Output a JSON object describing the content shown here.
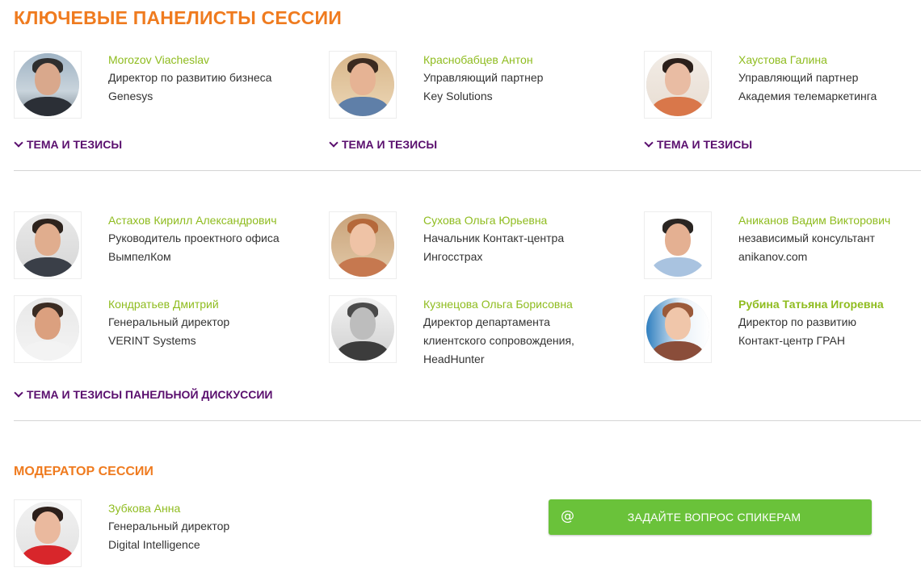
{
  "page": {
    "title": "КЛЮЧЕВЫЕ ПАНЕЛИСТЫ СЕССИИ",
    "moderator_title": "МОДЕРАТОР СЕССИИ",
    "ask_button": {
      "icon": "at-icon",
      "icon_glyph": "@",
      "label": "ЗАДАЙТЕ ВОПРОС СПИКЕРАМ"
    }
  },
  "colors": {
    "accent_orange": "#ef7b1f",
    "name_green": "#8fbc1f",
    "link_purple": "#5a0f6e",
    "button_green": "#6ac23a"
  },
  "panel1": {
    "speakers": [
      {
        "name": "Morozov Viacheslav",
        "lines": [
          "Директор по развитию бизнеса",
          "Genesys"
        ]
      },
      {
        "name": "Краснобабцев Антон",
        "lines": [
          "Управляющий партнер",
          "Key Solutions"
        ]
      },
      {
        "name": "Хаустова Галина",
        "lines": [
          "Управляющий партнер",
          "Академия телемаркетинга"
        ]
      }
    ],
    "theses_label": "ТЕМА И ТЕЗИСЫ"
  },
  "panel2": {
    "speakers": [
      {
        "name": "Астахов Кирилл Александрович",
        "lines": [
          "Руководитель проектного офиса",
          "ВымпелКом"
        ]
      },
      {
        "name": "Сухова Ольга Юрьевна",
        "lines": [
          "Начальник Контакт-центра",
          "Ингосстрах"
        ]
      },
      {
        "name": "Аниканов Вадим Викторович",
        "lines": [
          "независимый консультант",
          "anikanov.com"
        ]
      },
      {
        "name": "Кондратьев Дмитрий",
        "lines": [
          "Генеральный директор",
          "VERINT Systems"
        ]
      },
      {
        "name": "Кузнецова Ольга Борисовна",
        "lines": [
          "Директор департамента",
          "клиентского сопровождения,",
          "HeadHunter"
        ]
      },
      {
        "name": "Рубина Татьяна Игоревна",
        "lines": [
          "Директор по развитию",
          "Контакт-центр ГРАН"
        ]
      }
    ],
    "theses_label": "ТЕМА И ТЕЗИСЫ ПАНЕЛЬНОЙ ДИСКУССИИ"
  },
  "moderator": {
    "name": "Зубкова Анна",
    "lines": [
      "Генеральный директор",
      "Digital Intelligence"
    ]
  }
}
